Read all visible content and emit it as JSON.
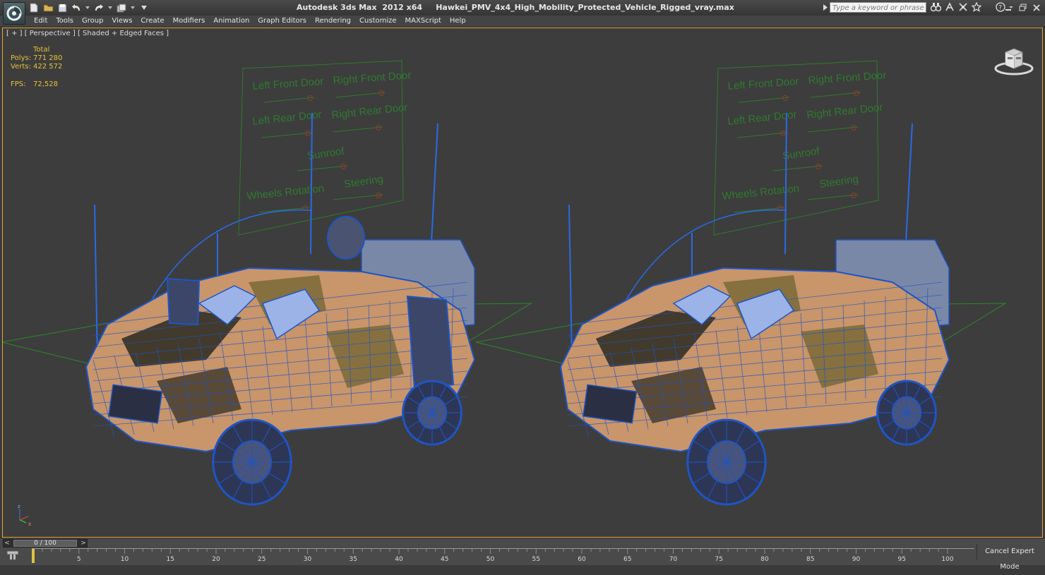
{
  "window": {
    "title": "Autodesk 3ds Max  2012 x64     Hawkei_PMV_4x4_High_Mobility_Protected_Vehicle_Rigged_vray.max",
    "search_placeholder": "Type a keyword or phrase"
  },
  "menu": [
    "Edit",
    "Tools",
    "Group",
    "Views",
    "Create",
    "Modifiers",
    "Animation",
    "Graph Editors",
    "Rendering",
    "Customize",
    "MAXScript",
    "Help"
  ],
  "viewport": {
    "label": "[ + ] [ Perspective ] [ Shaded + Edged Faces ]",
    "stats": {
      "total_label": "Total",
      "polys_label": "Polys:",
      "polys_value": "771 280",
      "verts_label": "Verts:",
      "verts_value": "422 572",
      "fps_label": "FPS:",
      "fps_value": "72,528"
    },
    "rig_panels": [
      {
        "labels": [
          "Left Front Door",
          "Right Front Door",
          "Left Rear Door",
          "Right Rear Door",
          "Sunroof",
          "Wheels Rotation",
          "Steering"
        ]
      },
      {
        "labels": [
          "Left Front Door",
          "Right Front Door",
          "Left Rear Door",
          "Right Rear Door",
          "Sunroof",
          "Wheels Rotation",
          "Steering"
        ]
      }
    ],
    "colors": {
      "background": "#3d3d3d",
      "wire": "#1f55c4",
      "wire_light": "#2a6ae6",
      "rig_green": "#2f7a2f",
      "ground_green": "#2a8a2a",
      "camo_tan": "#c9956a",
      "camo_olive": "#7a6a38",
      "camo_dark": "#2a2a22",
      "active_border": "#eda73a",
      "stats_text": "#e8c23b"
    }
  },
  "timeline": {
    "slider_label": "0 / 100",
    "ticks": [
      "5",
      "10",
      "15",
      "20",
      "25",
      "30",
      "35",
      "40",
      "45",
      "50",
      "55",
      "60",
      "65",
      "70",
      "75",
      "80",
      "85",
      "90",
      "95",
      "100"
    ],
    "cancel_expert_label": "Cancel Expert Mode"
  }
}
